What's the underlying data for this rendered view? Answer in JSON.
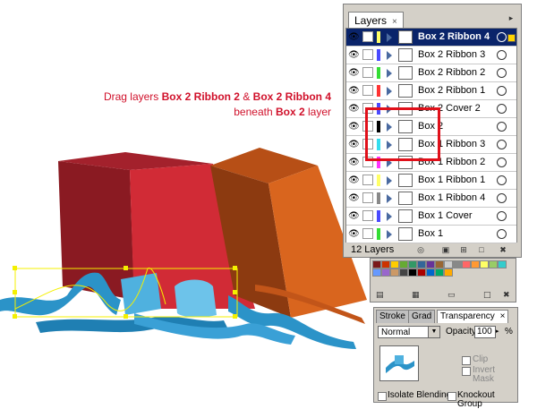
{
  "instruction": {
    "line1_prefix": "Drag layers ",
    "bold1": "Box 2 Ribbon 2",
    "mid": " & ",
    "bold2": "Box 2 Ribbon 4",
    "line2_prefix": "beneath ",
    "bold3": "Box 2",
    "line2_suffix": " layer"
  },
  "layers_panel": {
    "tab_label": "Layers",
    "close_glyph": "×",
    "menu_glyph": "▸",
    "layers": [
      {
        "name": "Box 2 Ribbon 4",
        "color": "#ffff66",
        "selected": true
      },
      {
        "name": "Box 2 Ribbon 3",
        "color": "#4a4aff",
        "selected": false
      },
      {
        "name": "Box 2 Ribbon 2",
        "color": "#33dd33",
        "selected": false
      },
      {
        "name": "Box 2 Ribbon 1",
        "color": "#ff3333",
        "selected": false
      },
      {
        "name": "Box 2 Cover 2",
        "color": "#4a4aff",
        "selected": false
      },
      {
        "name": "Box 2",
        "color": "#000000",
        "selected": false
      },
      {
        "name": "Box 1 Ribbon 3",
        "color": "#33ddee",
        "selected": false
      },
      {
        "name": "Box 1 Ribbon 2",
        "color": "#ff33ff",
        "selected": false
      },
      {
        "name": "Box 1 Ribbon 1",
        "color": "#ffff66",
        "selected": false
      },
      {
        "name": "Box 1 Ribbon 4",
        "color": "#888888",
        "selected": false
      },
      {
        "name": "Box 1 Cover",
        "color": "#4a4aff",
        "selected": false
      },
      {
        "name": "Box 1",
        "color": "#33dd33",
        "selected": false
      }
    ],
    "count_label": "12 Layers"
  },
  "transparency_panel": {
    "tabs": [
      "Stroke",
      "Grad",
      "Transparency"
    ],
    "active_tab": "Transparency",
    "close_glyph": "×",
    "blend_mode": "Normal",
    "opacity_label": "Opacity:",
    "opacity_value": "100",
    "opacity_unit": "%",
    "clip_label": "Clip",
    "invert_mask_label": "Invert Mask",
    "isolate_label": "Isolate Blending",
    "knockout_label": "Knockout Group"
  },
  "colors": {
    "highlight": "#e0101a",
    "instruction_text": "#d0102a",
    "selection": "#0a246a",
    "box_red": "#d12b36",
    "box_orange": "#d9651e",
    "ribbon_blue": "#2b93c8"
  }
}
